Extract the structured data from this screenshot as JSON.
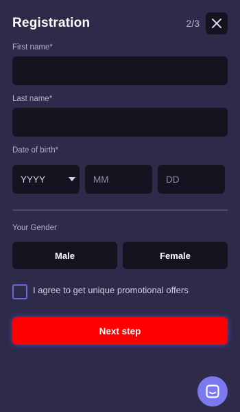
{
  "header": {
    "title": "Registration",
    "step": "2/3",
    "close_icon": "close-icon"
  },
  "form": {
    "first_name_label": "First name*",
    "first_name_value": "",
    "last_name_label": "Last name*",
    "last_name_value": "",
    "dob_label": "Date of birth*",
    "dob_year": "YYYY",
    "dob_month": "MM",
    "dob_day": "DD",
    "gender_label": "Your Gender",
    "gender_male": "Male",
    "gender_female": "Female",
    "agree_text": "I agree to get unique promotional offers",
    "agree_checked": false,
    "next_button": "Next step"
  },
  "chat": {
    "icon": "chat-icon"
  },
  "colors": {
    "background": "#2e2a4a",
    "field": "#15131f",
    "primary": "#ff0000",
    "accent": "#7c79ee"
  }
}
